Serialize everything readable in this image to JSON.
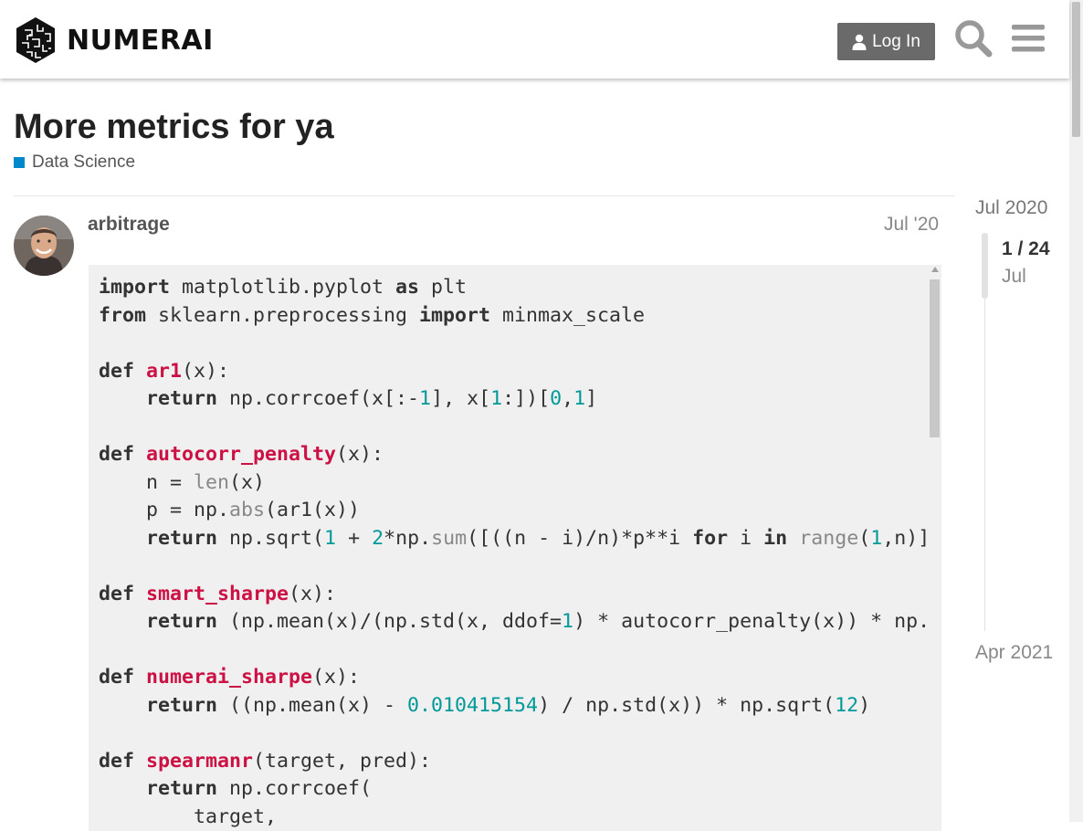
{
  "header": {
    "brand": "NUMERAI",
    "login_label": "Log In",
    "icons": [
      "user-icon",
      "search-icon",
      "hamburger-menu-icon"
    ]
  },
  "topic": {
    "title": "More metrics for ya",
    "category": "Data Science",
    "category_color": "#0088cc"
  },
  "post": {
    "author": "arbitrage",
    "date": "Jul '20"
  },
  "timeline": {
    "start": "Jul 2020",
    "position": "1 / 24",
    "current_month": "Jul",
    "end": "Apr 2021"
  },
  "code_lines": [
    "import matplotlib.pyplot as plt",
    "from sklearn.preprocessing import minmax_scale",
    "",
    "def ar1(x):",
    "    return np.corrcoef(x[:-1], x[1:])[0,1]",
    "",
    "def autocorr_penalty(x):",
    "    n = len(x)",
    "    p = np.abs(ar1(x))",
    "    return np.sqrt(1 + 2*np.sum([((n - i)/n)*p**i for i in range(1,n)]",
    "",
    "def smart_sharpe(x):",
    "    return (np.mean(x)/(np.std(x, ddof=1) * autocorr_penalty(x)) * np.",
    "",
    "def numerai_sharpe(x):",
    "    return ((np.mean(x) - 0.010415154) / np.std(x)) * np.sqrt(12)",
    "",
    "def spearmanr(target, pred):",
    "    return np.corrcoef(",
    "        target,"
  ]
}
